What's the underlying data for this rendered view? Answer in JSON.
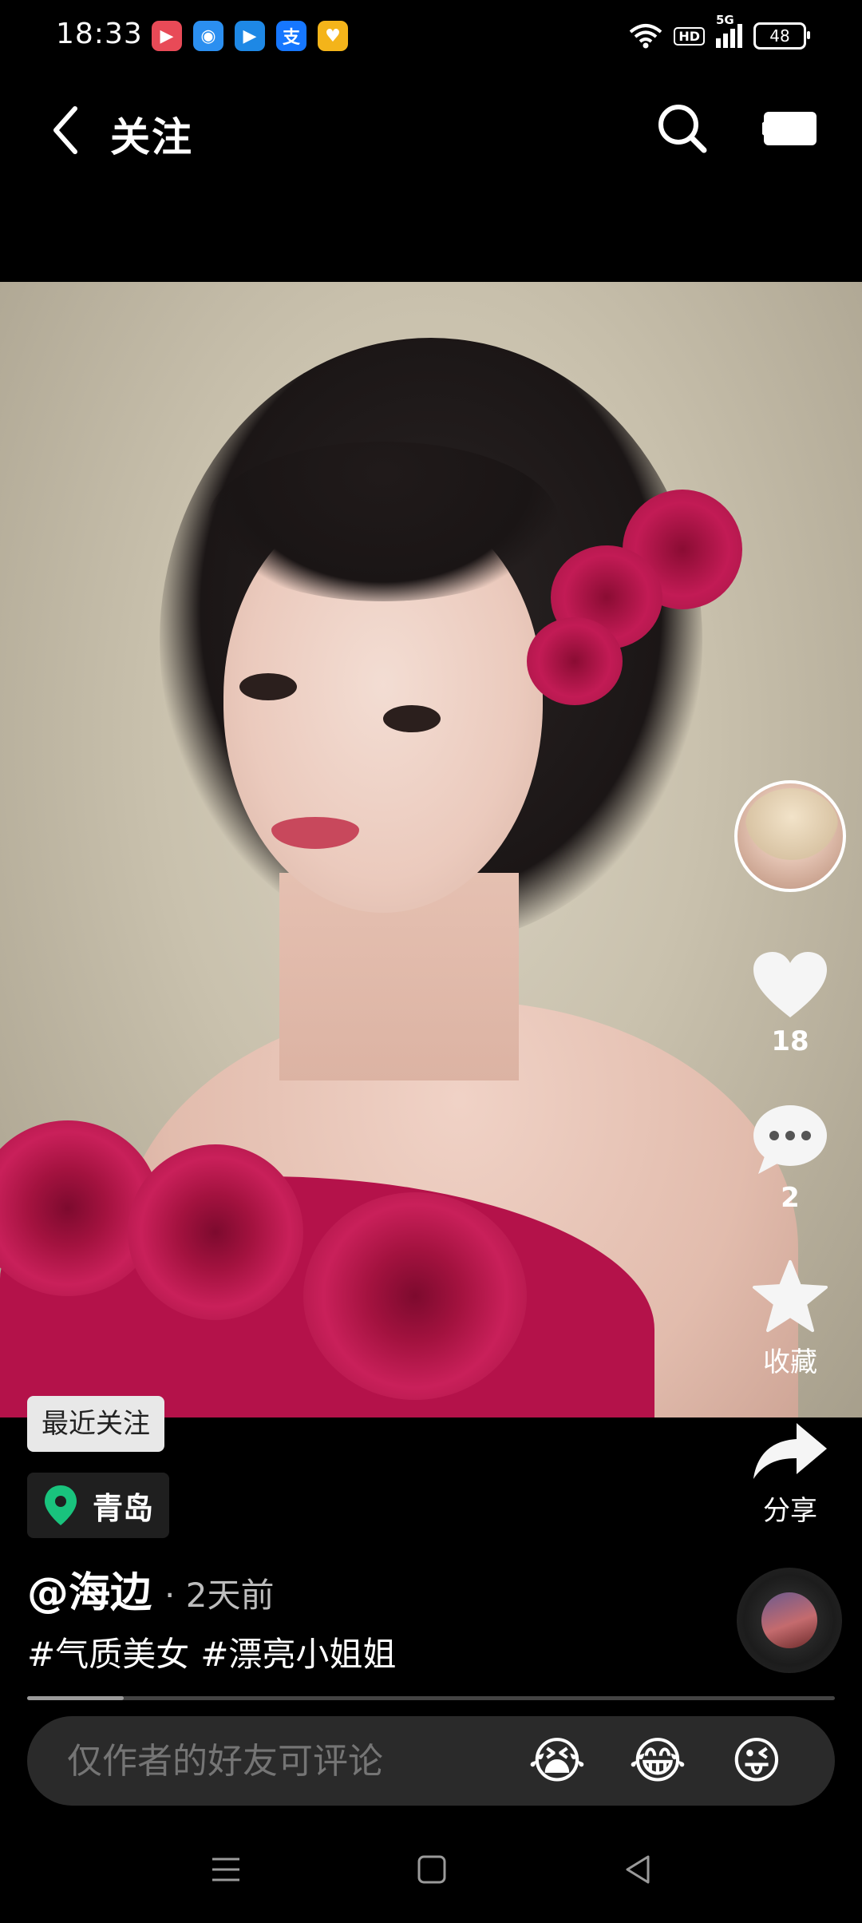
{
  "status_bar": {
    "time": "18:33",
    "battery": "48",
    "network_label": "5G",
    "hd_label": "HD",
    "apps": [
      {
        "name": "video-app-icon",
        "glyph": "▶",
        "color": "#e84a57"
      },
      {
        "name": "browser-app-icon",
        "glyph": "◉",
        "color": "#2b8ff0"
      },
      {
        "name": "player-app-icon",
        "glyph": "▶",
        "color": "#1e88e5"
      },
      {
        "name": "alipay-app-icon",
        "glyph": "支",
        "color": "#1677ff"
      },
      {
        "name": "wallet-app-icon",
        "glyph": "♥",
        "color": "#f4b41a"
      }
    ]
  },
  "header": {
    "title": "关注"
  },
  "actions": {
    "likes": "18",
    "comments": "2",
    "favorite_label": "收藏",
    "share_label": "分享"
  },
  "post": {
    "recent_tag": "最近关注",
    "location": "青岛",
    "author": "@海边",
    "time": "· 2天前",
    "hashtags": [
      "#气质美女",
      "#漂亮小姐姐"
    ],
    "progress_fraction": 0.12
  },
  "comment": {
    "placeholder": "仅作者的好友可评论",
    "emojis": [
      "😭",
      "😂",
      "😜"
    ]
  },
  "colors": {
    "location_pin": "#19c37d",
    "like_icon": "#f5f5f5",
    "accent_dress": "#b4124a"
  }
}
